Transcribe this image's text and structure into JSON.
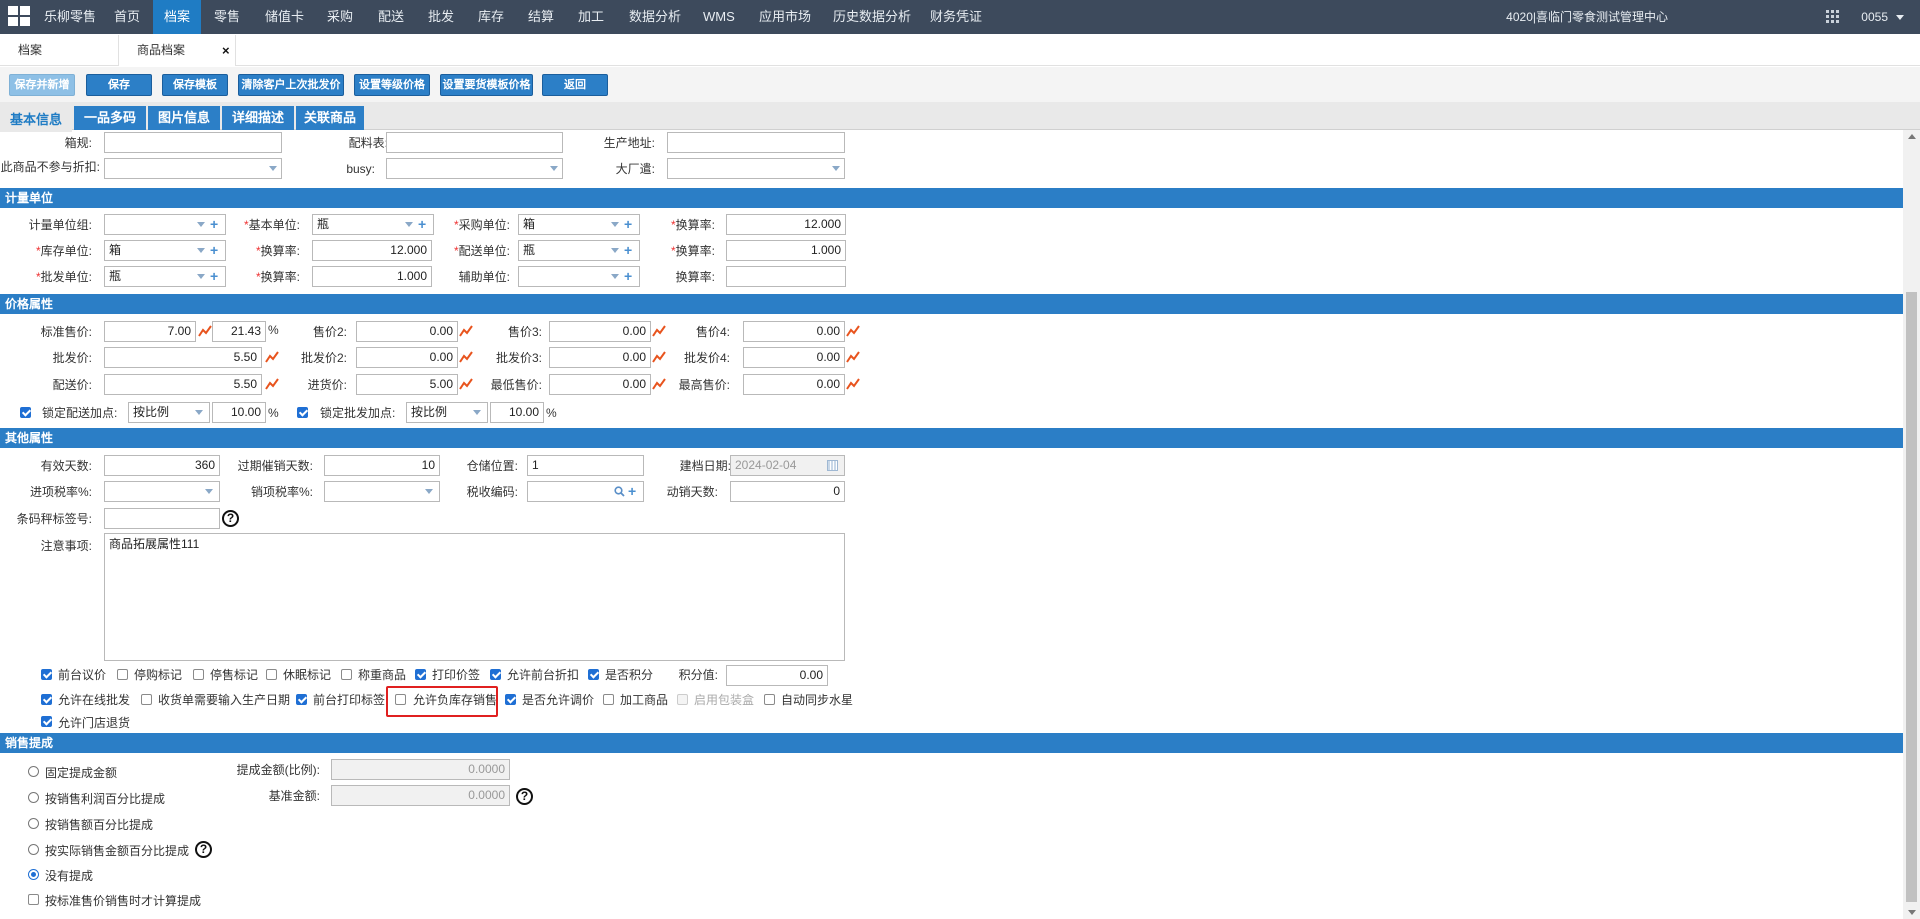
{
  "topnav": {
    "items": [
      "乐柳零售",
      "首页",
      "档案",
      "零售",
      "储值卡",
      "采购",
      "配送",
      "批发",
      "库存",
      "结算",
      "加工",
      "数据分析",
      "WMS",
      "应用市场",
      "历史数据分析",
      "财务凭证"
    ],
    "active": "档案",
    "org": "4020|喜临门零食测试管理中心",
    "user": "0055"
  },
  "pagetabs": [
    "档案",
    "商品档案"
  ],
  "toolbar": [
    "保存并新增",
    "保存",
    "保存模板",
    "清除客户上次批发价",
    "设置等级价格",
    "设置要货模板价格",
    "返回"
  ],
  "subtabs": [
    "基本信息",
    "一品多码",
    "图片信息",
    "详细描述",
    "关联商品"
  ],
  "top_fields": {
    "l1": "箱规:",
    "l2": "配料表:",
    "l3": "生产地址:",
    "l4": "此商品不参与折扣:",
    "l5": "busy:",
    "l6": "大厂遣:"
  },
  "sections": {
    "unit": "计量单位",
    "price": "价格属性",
    "other": "其他属性",
    "commission": "销售提成"
  },
  "unit": {
    "group_label": "计量单位组:",
    "base_label": "基本单位:",
    "base_value": "瓶",
    "purchase_label": "采购单位:",
    "purchase_value": "箱",
    "rate_label": "换算率:",
    "rate1": "12.000",
    "stock_label": "库存单位:",
    "stock_value": "箱",
    "rate2": "12.000",
    "dist_label": "配送单位:",
    "dist_value": "瓶",
    "rate3": "1.000",
    "whole_label": "批发单位:",
    "whole_value": "瓶",
    "rate4": "1.000",
    "aux_label": "辅助单位:",
    "rate5": ""
  },
  "price": {
    "std_label": "标准售价:",
    "std_value": "7.00",
    "std_pct": "21.43",
    "pct_sign": "%",
    "p2_label": "售价2:",
    "p2": "0.00",
    "p3_label": "售价3:",
    "p3": "0.00",
    "p4_label": "售价4:",
    "p4": "0.00",
    "w_label": "批发价:",
    "w": "5.50",
    "w2_label": "批发价2:",
    "w2": "0.00",
    "w3_label": "批发价3:",
    "w3": "0.00",
    "w4_label": "批发价4:",
    "w4": "0.00",
    "d_label": "配送价:",
    "d": "5.50",
    "in_label": "进货价:",
    "in": "5.00",
    "min_label": "最低售价:",
    "min": "0.00",
    "max_label": "最高售价:",
    "max": "0.00",
    "lock_dist_label": "锁定配送加点:",
    "lock_dist_mode": "按比例",
    "lock_dist_value": "10.00",
    "lock_whole_label": "锁定批发加点:",
    "lock_whole_mode": "按比例",
    "lock_whole_value": "10.00"
  },
  "other": {
    "valid_label": "有效天数:",
    "valid": "360",
    "overdue_label": "过期催销天数:",
    "overdue": "10",
    "storage_label": "仓储位置:",
    "storage": "1",
    "created_label": "建档日期:",
    "created": "2024-02-04",
    "intax_label": "进项税率%:",
    "saletax_label": "销项税率%:",
    "taxcode_label": "税收编码:",
    "move_label": "动销天数:",
    "move": "0",
    "barcode_label": "条码秤标签号:",
    "notes_label": "注意事项:",
    "notes": "商品拓展属性111",
    "points_label": "积分值:",
    "points": "0.00",
    "checks_row1": [
      {
        "label": "前台议价",
        "on": true
      },
      {
        "label": "停购标记",
        "on": false
      },
      {
        "label": "停售标记",
        "on": false
      },
      {
        "label": "休眠标记",
        "on": false
      },
      {
        "label": "称重商品",
        "on": false
      },
      {
        "label": "打印价签",
        "on": true
      },
      {
        "label": "允许前台折扣",
        "on": true
      },
      {
        "label": "是否积分",
        "on": true
      }
    ],
    "checks_row2": [
      {
        "label": "允许在线批发",
        "on": true
      },
      {
        "label": "收货单需要输入生产日期",
        "on": false
      },
      {
        "label": "前台打印标签",
        "on": true
      },
      {
        "label": "允许负库存销售",
        "on": false
      },
      {
        "label": "是否允许调价",
        "on": true
      },
      {
        "label": "加工商品",
        "on": false
      },
      {
        "label": "启用包装盒",
        "on": false
      },
      {
        "label": "自动同步水星",
        "on": false
      }
    ],
    "checks_row3": [
      {
        "label": "允许门店退货",
        "on": true
      }
    ]
  },
  "commission": {
    "options": [
      "固定提成金额",
      "按销售利润百分比提成",
      "按销售额百分比提成",
      "按实际销售金额百分比提成",
      "没有提成"
    ],
    "selected": 4,
    "amount_label": "提成金额(比例):",
    "amount": "0.0000",
    "base_label": "基准金额:",
    "base": "0.0000",
    "std_only_label": "按标准售价销售时才计算提成"
  },
  "colors": {
    "nav": "#3d4a5c",
    "accent": "#2b7ec6",
    "highlight": "#e02020"
  }
}
